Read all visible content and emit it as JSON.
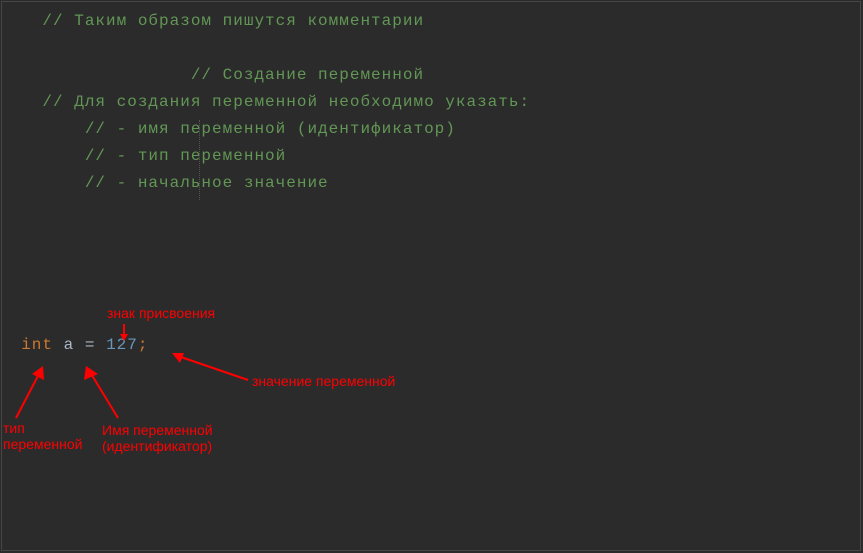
{
  "code": {
    "comment_line1": "// Таким образом пишутся комментарии",
    "comment_line2": "// Создание переменной",
    "comment_line3": "// Для создания переменной необходимо указать:",
    "comment_line4": "// - имя переменной (идентификатор)",
    "comment_line5": "// - тип переменной",
    "comment_line6": "// - начальное значение",
    "decl": {
      "keyword": "int",
      "identifier": "a",
      "operator": "=",
      "value": "127",
      "semicolon": ";"
    }
  },
  "annotations": {
    "assign_sign": "знак присвоения",
    "value_label": "значение переменной",
    "type_label_l1": "тип",
    "type_label_l2": "переменной",
    "name_label_l1": "Имя переменной",
    "name_label_l2": "(идентификатор)"
  },
  "colors": {
    "comment": "#629755",
    "keyword": "#cc7832",
    "number": "#6897bb",
    "annotation": "#ff0000",
    "background": "#2b2b2b"
  }
}
